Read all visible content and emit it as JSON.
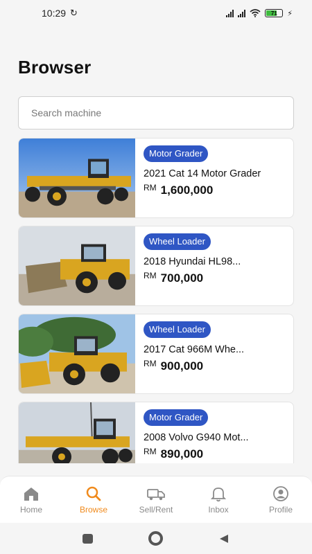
{
  "status": {
    "time": "10:29",
    "battery": "71"
  },
  "header": {
    "title": "Browser"
  },
  "search": {
    "placeholder": "Search machine"
  },
  "listings": [
    {
      "category": "Motor Grader",
      "title": "2021 Cat 14 Motor Grader",
      "currency": "RM",
      "price": "1,600,000"
    },
    {
      "category": "Wheel Loader",
      "title": "2018 Hyundai HL98...",
      "currency": "RM",
      "price": "700,000"
    },
    {
      "category": "Wheel Loader",
      "title": "2017 Cat 966M Whe...",
      "currency": "RM",
      "price": "900,000"
    },
    {
      "category": "Motor Grader",
      "title": "2008 Volvo G940 Mot...",
      "currency": "RM",
      "price": "890,000"
    }
  ],
  "nav": {
    "home": "Home",
    "browse": "Browse",
    "sell": "Sell/Rent",
    "inbox": "Inbox",
    "profile": "Profile"
  },
  "colors": {
    "accent": "#f08a1c",
    "badge": "#2f56c4",
    "machine": "#d9a520"
  }
}
